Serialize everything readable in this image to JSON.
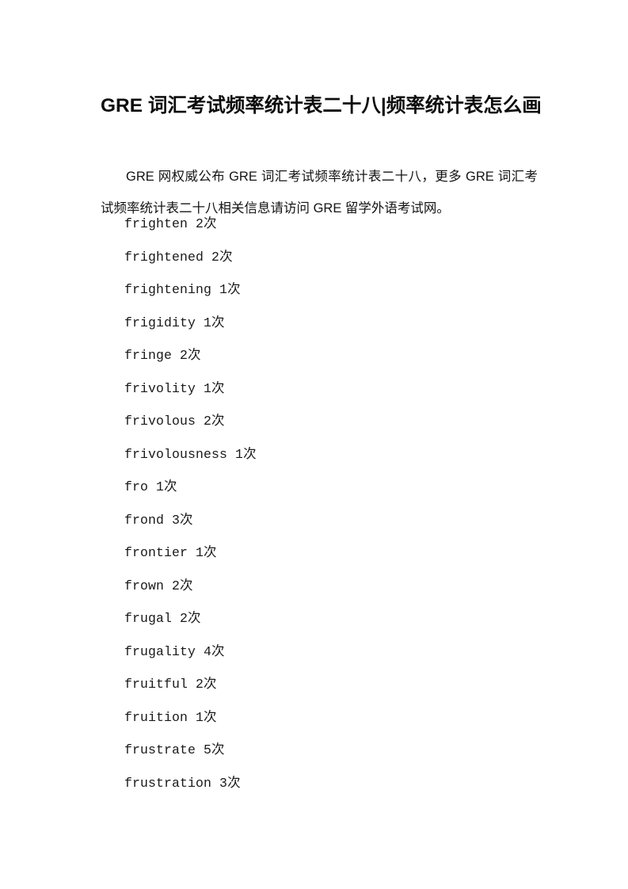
{
  "document": {
    "title": "GRE 词汇考试频率统计表二十八|频率统计表怎么画",
    "intro": "GRE 网权威公布 GRE 词汇考试频率统计表二十八，更多 GRE 词汇考试频率统计表二十八相关信息请访问 GRE 留学外语考试网。",
    "background_color": "#ffffff",
    "text_color": "#141414"
  },
  "word_list": {
    "unit_label": "次",
    "entries": [
      {
        "term": "frighten",
        "count": "2",
        "unit": "次"
      },
      {
        "term": "frightened",
        "count": "2",
        "unit": "次"
      },
      {
        "term": "frightening",
        "count": "1",
        "unit": "次"
      },
      {
        "term": "frigidity",
        "count": "1",
        "unit": "次"
      },
      {
        "term": "fringe",
        "count": "2",
        "unit": "次"
      },
      {
        "term": "frivolity",
        "count": "1",
        "unit": "次"
      },
      {
        "term": "frivolous",
        "count": "2",
        "unit": "次"
      },
      {
        "term": "frivolousness",
        "count": "1",
        "unit": "次"
      },
      {
        "term": "fro",
        "count": "1",
        "unit": "次"
      },
      {
        "term": "frond",
        "count": "3",
        "unit": "次"
      },
      {
        "term": "frontier",
        "count": "1",
        "unit": "次"
      },
      {
        "term": "frown",
        "count": "2",
        "unit": "次"
      },
      {
        "term": "frugal",
        "count": "2",
        "unit": "次"
      },
      {
        "term": "frugality",
        "count": "4",
        "unit": "次"
      },
      {
        "term": "fruitful",
        "count": "2",
        "unit": "次"
      },
      {
        "term": "fruition",
        "count": "1",
        "unit": "次"
      },
      {
        "term": "frustrate",
        "count": "5",
        "unit": "次"
      },
      {
        "term": "frustration",
        "count": "3",
        "unit": "次"
      }
    ]
  }
}
